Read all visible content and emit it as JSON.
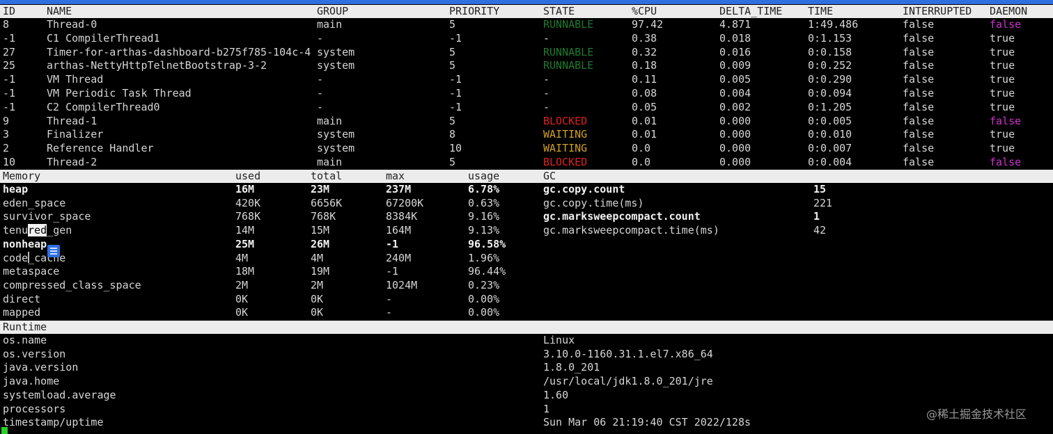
{
  "threads": {
    "headers": [
      "ID",
      "NAME",
      "GROUP",
      "PRIORITY",
      "STATE",
      "%CPU",
      "DELTA_TIME",
      "TIME",
      "INTERRUPTED",
      "DAEMON"
    ],
    "rows": [
      {
        "id": "8",
        "name": "Thread-0",
        "group": "main",
        "priority": "5",
        "state": "RUNNABLE",
        "cpu": "97.42",
        "delta": "4.871",
        "time": "1:49.486",
        "interrupted": "false",
        "daemon": "false"
      },
      {
        "id": "-1",
        "name": "C1 CompilerThread1",
        "group": "-",
        "priority": "-1",
        "state": "-",
        "cpu": "0.38",
        "delta": "0.018",
        "time": "0:1.153",
        "interrupted": "false",
        "daemon": "true"
      },
      {
        "id": "27",
        "name": "Timer-for-arthas-dashboard-b275f785-104c-4",
        "group": "system",
        "priority": "5",
        "state": "RUNNABLE",
        "cpu": "0.32",
        "delta": "0.016",
        "time": "0:0.158",
        "interrupted": "false",
        "daemon": "true"
      },
      {
        "id": "25",
        "name": "arthas-NettyHttpTelnetBootstrap-3-2",
        "group": "system",
        "priority": "5",
        "state": "RUNNABLE",
        "cpu": "0.18",
        "delta": "0.009",
        "time": "0:0.252",
        "interrupted": "false",
        "daemon": "true"
      },
      {
        "id": "-1",
        "name": "VM Thread",
        "group": "-",
        "priority": "-1",
        "state": "-",
        "cpu": "0.11",
        "delta": "0.005",
        "time": "0:0.290",
        "interrupted": "false",
        "daemon": "true"
      },
      {
        "id": "-1",
        "name": "VM Periodic Task Thread",
        "group": "-",
        "priority": "-1",
        "state": "-",
        "cpu": "0.08",
        "delta": "0.004",
        "time": "0:0.094",
        "interrupted": "false",
        "daemon": "true"
      },
      {
        "id": "-1",
        "name": "C2 CompilerThread0",
        "group": "-",
        "priority": "-1",
        "state": "-",
        "cpu": "0.05",
        "delta": "0.002",
        "time": "0:1.205",
        "interrupted": "false",
        "daemon": "true"
      },
      {
        "id": "9",
        "name": "Thread-1",
        "group": "main",
        "priority": "5",
        "state": "BLOCKED",
        "cpu": "0.01",
        "delta": "0.000",
        "time": "0:0.005",
        "interrupted": "false",
        "daemon": "false"
      },
      {
        "id": "3",
        "name": "Finalizer",
        "group": "system",
        "priority": "8",
        "state": "WAITING",
        "cpu": "0.01",
        "delta": "0.000",
        "time": "0:0.010",
        "interrupted": "false",
        "daemon": "true"
      },
      {
        "id": "2",
        "name": "Reference Handler",
        "group": "system",
        "priority": "10",
        "state": "WAITING",
        "cpu": "0.0",
        "delta": "0.000",
        "time": "0:0.007",
        "interrupted": "false",
        "daemon": "true"
      },
      {
        "id": "10",
        "name": "Thread-2",
        "group": "main",
        "priority": "5",
        "state": "BLOCKED",
        "cpu": "0.0",
        "delta": "0.000",
        "time": "0:0.004",
        "interrupted": "false",
        "daemon": "false"
      }
    ]
  },
  "memory": {
    "headers": [
      "Memory",
      "used",
      "total",
      "max",
      "usage",
      "GC"
    ],
    "rows": [
      {
        "name": "heap",
        "used": "16M",
        "total": "23M",
        "max": "237M",
        "usage": "6.78%",
        "bold": true
      },
      {
        "name": "eden_space",
        "used": "420K",
        "total": "6656K",
        "max": "67200K",
        "usage": "0.63%",
        "bold": false
      },
      {
        "name": "survivor_space",
        "used": "768K",
        "total": "768K",
        "max": "8384K",
        "usage": "9.16%",
        "bold": false
      },
      {
        "name": "tenured_gen",
        "used": "14M",
        "total": "15M",
        "max": "164M",
        "usage": "9.13%",
        "bold": false
      },
      {
        "name": "nonheap",
        "used": "25M",
        "total": "26M",
        "max": "-1",
        "usage": "96.58%",
        "bold": true
      },
      {
        "name": "code_cache",
        "used": "4M",
        "total": "4M",
        "max": "240M",
        "usage": "1.96%",
        "bold": false
      },
      {
        "name": "metaspace",
        "used": "18M",
        "total": "19M",
        "max": "-1",
        "usage": "96.44%",
        "bold": false
      },
      {
        "name": "compressed_class_space",
        "used": "2M",
        "total": "2M",
        "max": "1024M",
        "usage": "0.23%",
        "bold": false
      },
      {
        "name": "direct",
        "used": "0K",
        "total": "0K",
        "max": "-",
        "usage": "0.00%",
        "bold": false
      },
      {
        "name": "mapped",
        "used": "0K",
        "total": "0K",
        "max": "-",
        "usage": "0.00%",
        "bold": false
      }
    ]
  },
  "gc": {
    "rows": [
      {
        "name": "gc.copy.count",
        "value": "15",
        "bold": true
      },
      {
        "name": "gc.copy.time(ms)",
        "value": "221",
        "bold": false
      },
      {
        "name": "gc.marksweepcompact.count",
        "value": "1",
        "bold": true
      },
      {
        "name": "gc.marksweepcompact.time(ms)",
        "value": "42",
        "bold": false
      }
    ]
  },
  "runtime": {
    "header": "Runtime",
    "rows": [
      {
        "name": "os.name",
        "value": "Linux"
      },
      {
        "name": "os.version",
        "value": "3.10.0-1160.31.1.el7.x86_64"
      },
      {
        "name": "java.version",
        "value": "1.8.0_201"
      },
      {
        "name": "java.home",
        "value": "/usr/local/jdk1.8.0_201/jre"
      },
      {
        "name": "systemload.average",
        "value": "1.60"
      },
      {
        "name": "processors",
        "value": "1"
      },
      {
        "name": "timestamp/uptime",
        "value": "Sun Mar 06 21:19:40 CST 2022/128s"
      }
    ]
  },
  "watermark": "@稀土掘金技术社区",
  "colors": {
    "running": "#1e7a2e",
    "blocked": "#e02020",
    "waiting": "#d0a020",
    "daemon_false": "#d22fd2",
    "header_bg": "#ececec"
  },
  "icons": [
    "document-icon",
    "text-cursor-icon",
    "terminal-cursor-icon"
  ]
}
